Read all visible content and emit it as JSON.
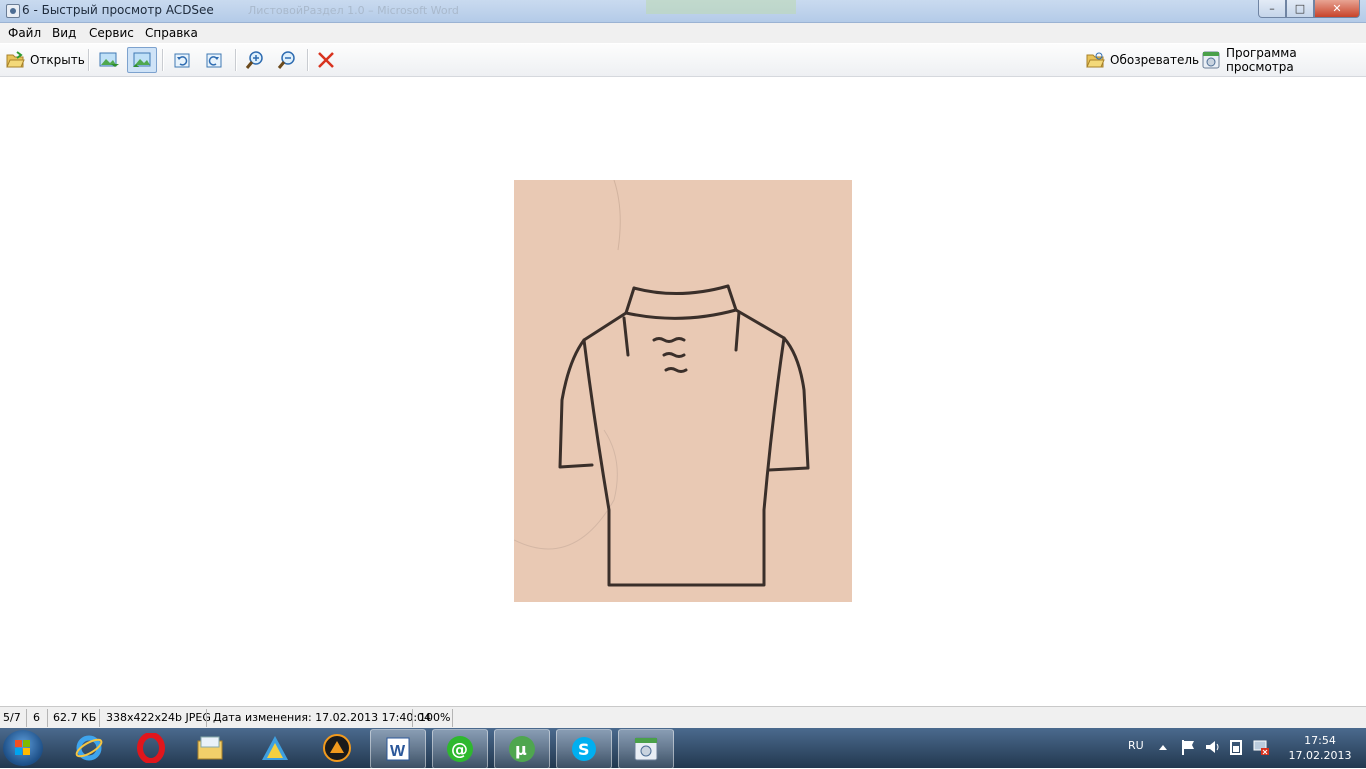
{
  "window": {
    "title": "6 - Быстрый просмотр ACDSee",
    "background_title": "ЛистовойРаздел 1.0 – Microsoft Word",
    "min_glyph": "–",
    "max_glyph": "□",
    "close_glyph": "✕"
  },
  "menu": {
    "file": "Файл",
    "view": "Вид",
    "service": "Сервис",
    "help": "Справка"
  },
  "toolbar": {
    "open_label": "Открыть",
    "browser_label": "Обозреватель",
    "viewer_label": "Программа просмотра"
  },
  "status": {
    "position": "5/7",
    "name": "6",
    "size": "62.7 КБ",
    "format": "338x422x24b JPEG",
    "modified": "Дата изменения: 17.02.2013 17:40:04",
    "zoom": "100%"
  },
  "tray": {
    "lang": "RU",
    "time": "17:54",
    "date": "17.02.2013"
  },
  "colors": {
    "photo_bg": "#e9c9b4",
    "accent": "#1d4f87",
    "close_red": "#c7432a"
  }
}
